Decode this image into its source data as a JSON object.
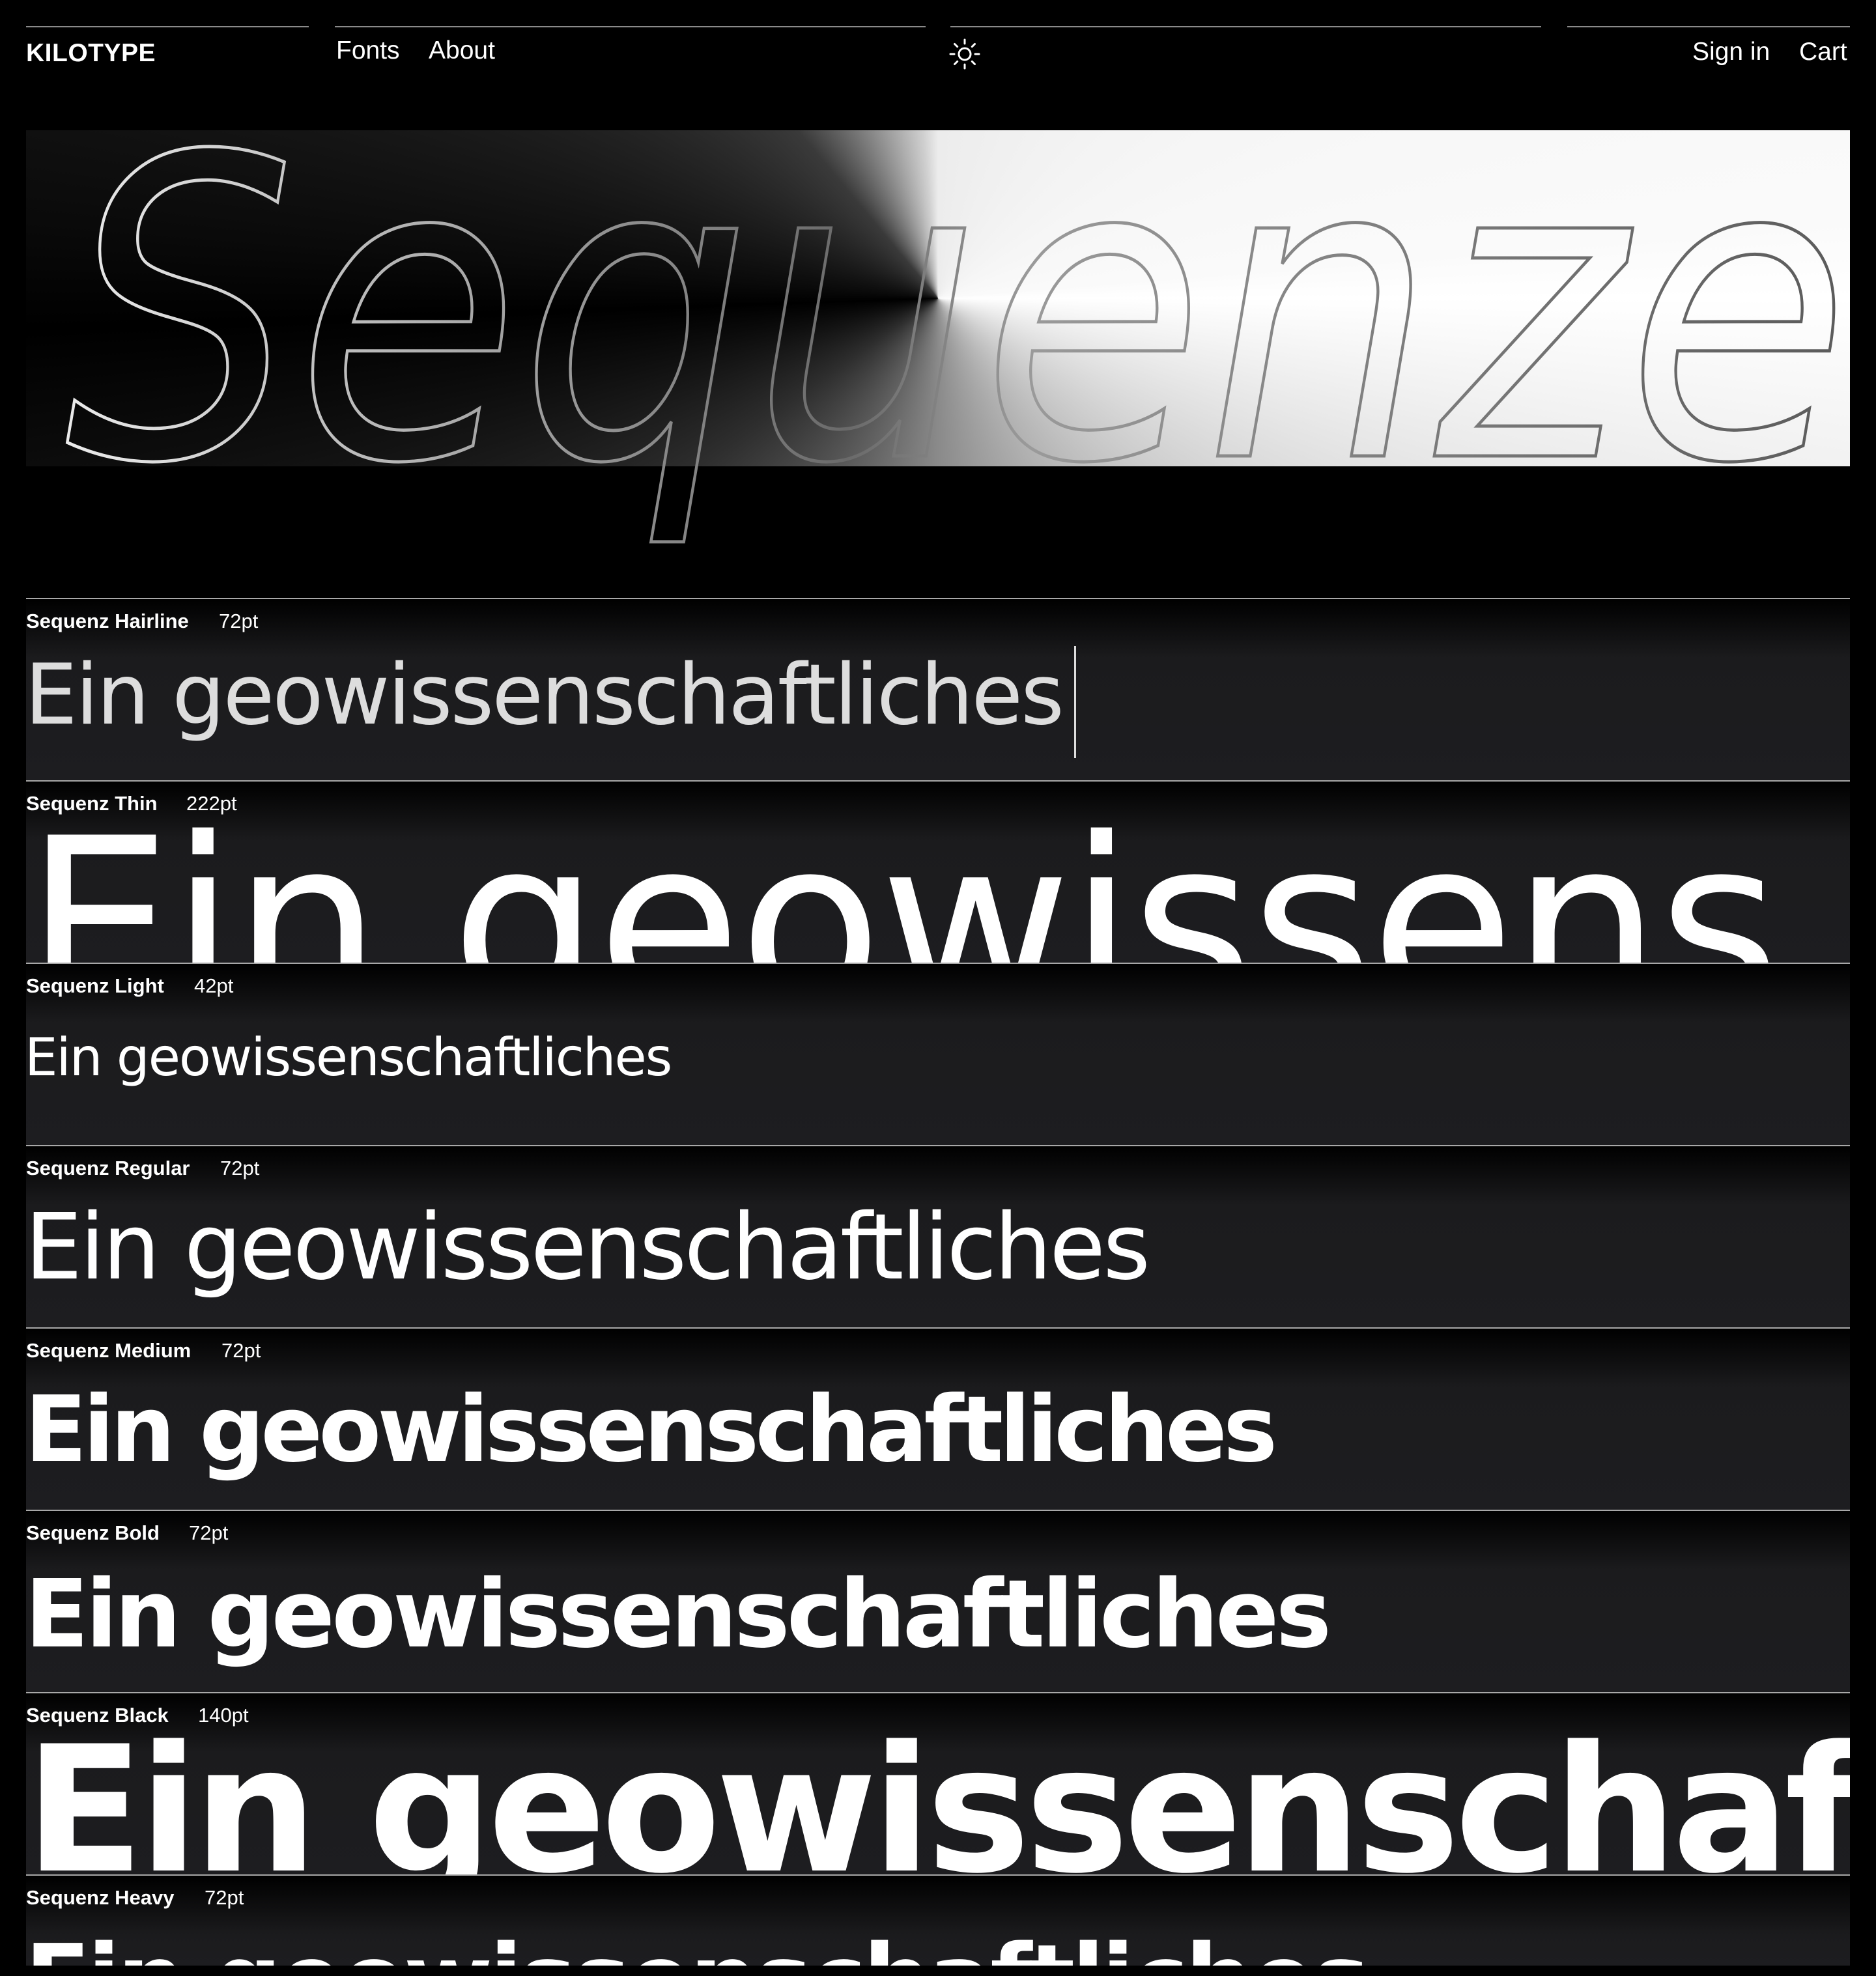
{
  "header": {
    "brand": "KILOTYPE",
    "nav": {
      "fonts": "Fonts",
      "about": "About"
    },
    "theme_icon": "sun-icon",
    "account": {
      "sign_in": "Sign in",
      "cart": "Cart"
    }
  },
  "hero": {
    "word": "Sequenze"
  },
  "specimens": [
    {
      "name": "Sequenz Hairline",
      "size": "72pt",
      "sample": "Ein geowissenschaftliches"
    },
    {
      "name": "Sequenz Thin",
      "size": "222pt",
      "sample": "Ein geowissens"
    },
    {
      "name": "Sequenz Light",
      "size": "42pt",
      "sample": "Ein geowissenschaftliches"
    },
    {
      "name": "Sequenz Regular",
      "size": "72pt",
      "sample": "Ein geowissenschaftliches"
    },
    {
      "name": "Sequenz Medium",
      "size": "72pt",
      "sample": "Ein geowissenschaftliches"
    },
    {
      "name": "Sequenz Bold",
      "size": "72pt",
      "sample": "Ein geowissenschaftliches"
    },
    {
      "name": "Sequenz Black",
      "size": "140pt",
      "sample": "Ein geowissenschaft"
    },
    {
      "name": "Sequenz Heavy",
      "size": "72pt",
      "sample": "Ein geowissenschaftliches"
    }
  ],
  "colors": {
    "background": "#000000",
    "row_background": "#1d1d20",
    "text": "#ffffff",
    "rule": "#a8a8a8"
  }
}
